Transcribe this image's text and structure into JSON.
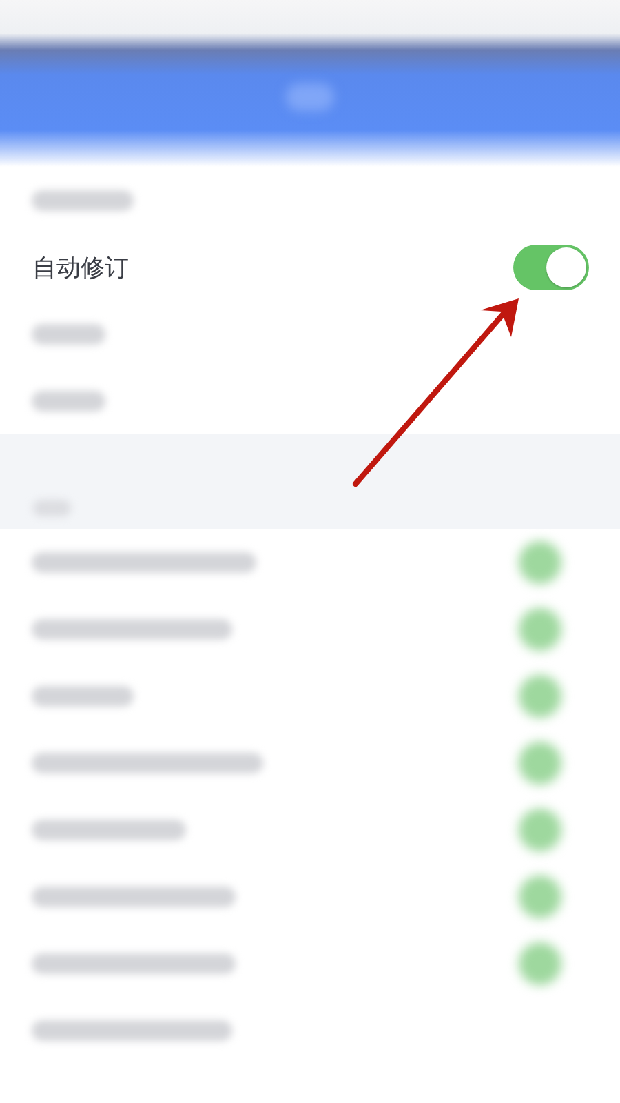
{
  "settings": [
    {
      "kind": "blurred"
    },
    {
      "kind": "switch",
      "label": "自动修订",
      "on": true
    },
    {
      "kind": "blurred"
    },
    {
      "kind": "blurred"
    }
  ],
  "section": {
    "rows": [
      {
        "kind": "blurred_switch",
        "on": true
      },
      {
        "kind": "blurred_switch",
        "on": true
      },
      {
        "kind": "blurred_switch",
        "on": true
      },
      {
        "kind": "blurred_switch",
        "on": true
      },
      {
        "kind": "blurred_switch",
        "on": true
      },
      {
        "kind": "blurred_switch",
        "on": true
      },
      {
        "kind": "blurred_switch",
        "on": true
      },
      {
        "kind": "blurred"
      }
    ]
  }
}
